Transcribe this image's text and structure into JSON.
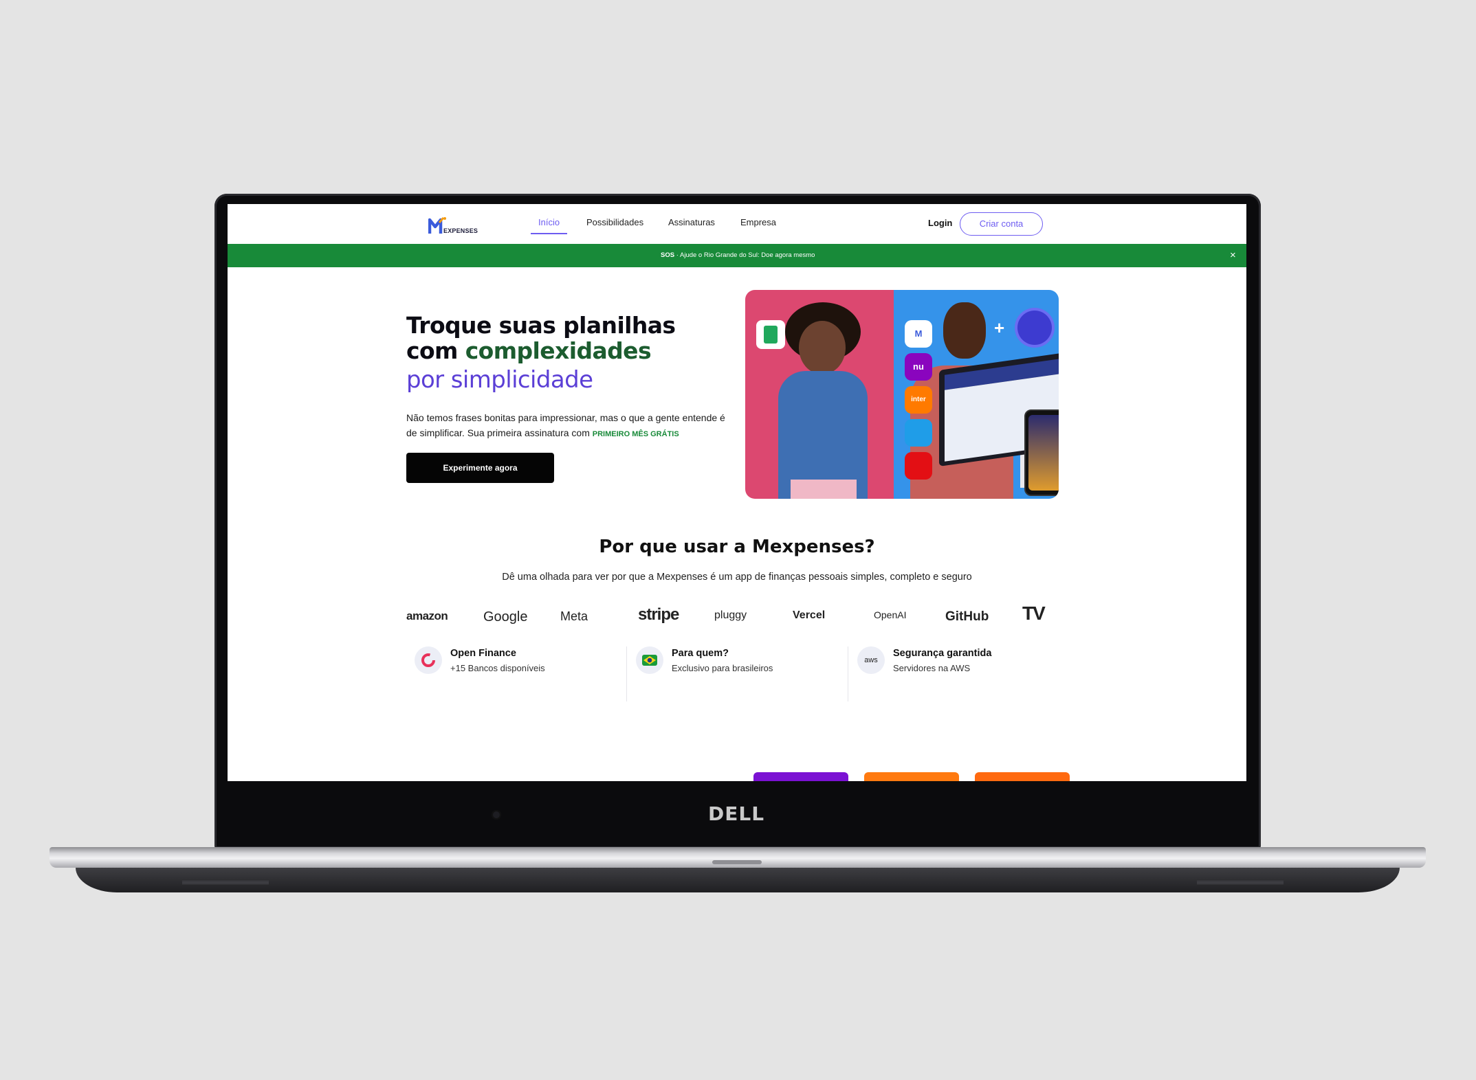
{
  "header": {
    "logo_text": "EXPENSES",
    "nav": [
      "Início",
      "Possibilidades",
      "Assinaturas",
      "Empresa"
    ],
    "login": "Login",
    "signup": "Criar conta"
  },
  "banner": {
    "tag": "SOS",
    "sep": "·",
    "text": "Ajude o Rio Grande do Sul: Doe agora mesmo",
    "close": "×"
  },
  "hero": {
    "line1": "Troque suas planilhas",
    "line2_a": "com ",
    "line2_b": "complexidades",
    "line3": "por simplicidade",
    "sub_a": "Não temos frases bonitas para impressionar, mas o que a gente entende é de simplificar. Sua primeira assinatura com ",
    "sub_b": "PRIMEIRO MÊS GRÁTIS",
    "cta": "Experimente agora"
  },
  "hero_image": {
    "apps": [
      "nu",
      "inter"
    ]
  },
  "why": {
    "title": "Por que usar a Mexpenses?",
    "subtitle": "Dê uma olhada para ver por que a Mexpenses é um app de finanças pessoais simples, completo e seguro",
    "brands": [
      "amazon",
      "Google",
      "Meta",
      "stripe",
      "pluggy",
      "Vercel",
      "OpenAI",
      "GitHub",
      "TV"
    ],
    "features": [
      {
        "title": "Open Finance",
        "desc": "+15 Bancos disponíveis"
      },
      {
        "title": "Para quem?",
        "desc": "Exclusivo para brasileiros"
      },
      {
        "title": "Segurança garantida",
        "desc": "Servidores na AWS"
      }
    ],
    "aws_label": "aws"
  },
  "device": {
    "brand": "DELL"
  },
  "colors": {
    "accent": "#6d5cf1",
    "banner": "#188a39",
    "heading_green": "#1c5c2f",
    "purple": "#5b3fd6"
  }
}
